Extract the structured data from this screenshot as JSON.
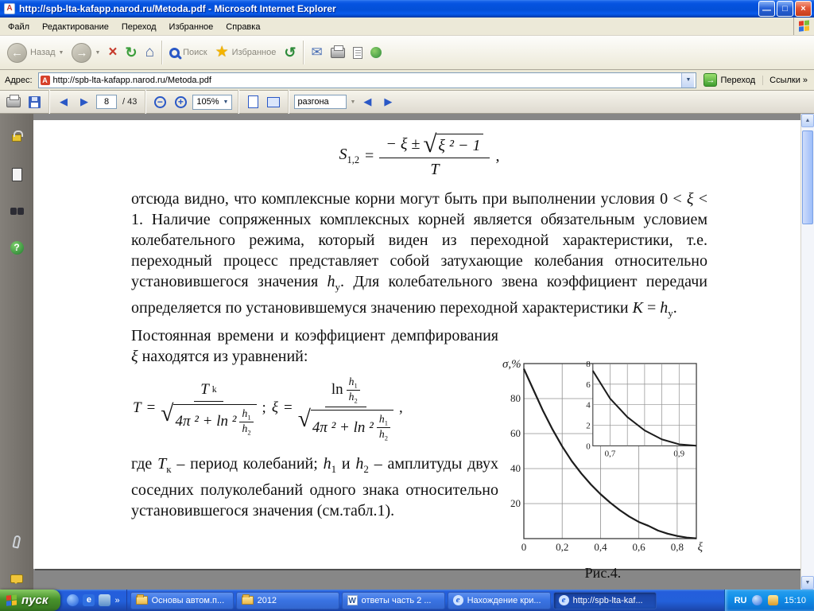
{
  "window": {
    "title": "http://spb-lta-kafapp.narod.ru/Metoda.pdf - Microsoft Internet Explorer"
  },
  "menu": {
    "items": [
      "Файл",
      "Редактирование",
      "Переход",
      "Избранное",
      "Справка"
    ]
  },
  "ie_toolbar": {
    "back": "Назад",
    "search": "Поиск",
    "favorites": "Избранное"
  },
  "address": {
    "label": "Адрес:",
    "value": "http://spb-lta-kafapp.narod.ru/Metoda.pdf",
    "go": "Переход",
    "links": "Ссылки"
  },
  "acro": {
    "page": "8",
    "total": "/ 43",
    "zoom": "105%",
    "search": "разгона"
  },
  "icons": {
    "back": "←",
    "forward": "→",
    "stop": "×",
    "refresh": "↻",
    "home": "⌂",
    "star": "★",
    "history": "↺",
    "mail": "✉",
    "dropdown": "▼",
    "chevron": "»",
    "prev": "◀",
    "next": "▶",
    "minus": "−",
    "plus": "+",
    "help": "?",
    "up": "▲",
    "down": "▼",
    "word_glyph": "W",
    "ie_glyph": "e",
    "pdf_glyph": "A",
    "go_arrow": "→",
    "min_glyph": "—",
    "max_glyph": "□",
    "close_glyph": "×"
  },
  "colors": {
    "xp_title_blue": "#0353d7",
    "xp_chrome": "#ece9d8",
    "start_green": "#48932c",
    "task_button_blue": "#3a74e4",
    "tray_blue": "#1290e9",
    "xp_red": "#e23c26",
    "xp_green": "#7bbf38",
    "xp_blue": "#2f6fe0",
    "xp_yellow": "#f5bd27"
  },
  "document": {
    "para1_rich": [
      {
        "t": "отсюда видно, что комплексные корни могут быть при выполнении условия 0 < "
      },
      {
        "t": "ξ",
        "s": "i"
      },
      {
        "t": " < 1. Наличие сопряженных комплексных корней является обязательным условием колебательного режима, который виден из переходной характеристики, т.е. переходный процесс представляет собой затухающие колебания относительно установившегося значения "
      },
      {
        "t": "h",
        "s": "i"
      },
      {
        "t": "у",
        "s": "sub"
      },
      {
        "t": ". Для колебательного звена коэффициент передачи определяется по установившемуся значению переходной характеристики "
      },
      {
        "t": "K",
        "s": "i"
      },
      {
        "t": " = "
      },
      {
        "t": "h",
        "s": "i"
      },
      {
        "t": "у",
        "s": "sub"
      },
      {
        "t": "."
      }
    ],
    "colA_rich": [
      {
        "t": "Постоянная времени и коэффициент демпфирования "
      },
      {
        "t": "ξ",
        "s": "i"
      },
      {
        "t": " находятся из уравнений:"
      }
    ],
    "colB_rich": [
      {
        "t": "где "
      },
      {
        "t": "T",
        "s": "i"
      },
      {
        "t": "к",
        "s": "sub"
      },
      {
        "t": " – период колебаний; "
      },
      {
        "t": "h",
        "s": "i"
      },
      {
        "t": "1",
        "s": "sub"
      },
      {
        "t": " и "
      },
      {
        "t": "h",
        "s": "i"
      },
      {
        "t": "2",
        "s": "sub"
      },
      {
        "t": " – амплитуды двух соседних полуколебаний одного знака относительно установившегося значения (см.табл.1)."
      }
    ],
    "figure_caption": "Рис.4."
  },
  "math": {
    "sqrt": "√",
    "f1": {
      "lhs": "S",
      "lhs_sub": "1,2",
      "eq": "=",
      "num_pre": "− ξ ±",
      "radicand": "ξ ² − 1",
      "den": "T",
      "tail": ","
    },
    "f2": {
      "lhs": "T",
      "eq": "=",
      "tk": "T",
      "tk_sub": "k",
      "semi": ";",
      "xi": "ξ",
      "eq2": "=",
      "ln": "ln",
      "expr": "4π ² + ln ²",
      "h": "h",
      "s1": "1",
      "s2": "2",
      "tail": ","
    }
  },
  "chart_data": {
    "type": "line",
    "title": "Рис.4.",
    "ylabel": "σ,%",
    "xlabel": "ξ",
    "xlim": [
      0,
      0.9
    ],
    "ylim": [
      0,
      100
    ],
    "grid": true,
    "grid_step": {
      "x": 0.2,
      "y": 20
    },
    "x_ticks": [
      {
        "v": 0,
        "label": "0"
      },
      {
        "v": 0.2,
        "label": "0,2"
      },
      {
        "v": 0.4,
        "label": "0,4"
      },
      {
        "v": 0.6,
        "label": "0,6"
      },
      {
        "v": 0.8,
        "label": "0,8"
      }
    ],
    "y_ticks": [
      {
        "v": 20,
        "label": "20"
      },
      {
        "v": 40,
        "label": "40"
      },
      {
        "v": 60,
        "label": "60"
      },
      {
        "v": 80,
        "label": "80"
      }
    ],
    "series": [
      {
        "name": "overshoot_sigma_vs_xi",
        "x": [
          0,
          0.05,
          0.1,
          0.15,
          0.2,
          0.25,
          0.3,
          0.35,
          0.4,
          0.45,
          0.5,
          0.55,
          0.6,
          0.65,
          0.7,
          0.75,
          0.8,
          0.85,
          0.9
        ],
        "y": [
          97,
          85,
          73,
          62.3,
          52.7,
          44.3,
          37.2,
          30.9,
          25.4,
          20.6,
          16.3,
          12.6,
          9.5,
          7.3,
          4.6,
          2.8,
          1.5,
          0.6,
          0.15
        ]
      }
    ],
    "inset": {
      "xlim": [
        0.65,
        0.95
      ],
      "ylim": [
        0,
        8
      ],
      "grid_step": {
        "x": 0.05,
        "y": 2
      },
      "x_ticks": [
        {
          "v": 0.7,
          "label": "0,7"
        },
        {
          "v": 0.9,
          "label": "0,9"
        }
      ],
      "y_ticks": [
        {
          "v": 0,
          "label": "0"
        },
        {
          "v": 2,
          "label": "2"
        },
        {
          "v": 4,
          "label": "4"
        },
        {
          "v": 6,
          "label": "6"
        },
        {
          "v": 8,
          "label": "8"
        }
      ],
      "x": [
        0.65,
        0.7,
        0.75,
        0.8,
        0.85,
        0.9,
        0.95
      ],
      "y": [
        7.3,
        4.6,
        2.8,
        1.5,
        0.63,
        0.15,
        0.01
      ]
    }
  },
  "taskbar": {
    "start": "пуск",
    "ql_chevron": "»",
    "buttons": [
      {
        "label": "Основы автом.п...",
        "icon": "folder",
        "active": false
      },
      {
        "label": "2012",
        "icon": "folder",
        "active": false
      },
      {
        "label": "ответы часть 2 ...",
        "icon": "word",
        "active": false
      },
      {
        "label": "Нахождение кри...",
        "icon": "ie",
        "active": false
      },
      {
        "label": "http://spb-lta-kaf...",
        "icon": "ie",
        "active": true
      }
    ],
    "tray": {
      "lang": "RU",
      "time": "15:10"
    }
  }
}
